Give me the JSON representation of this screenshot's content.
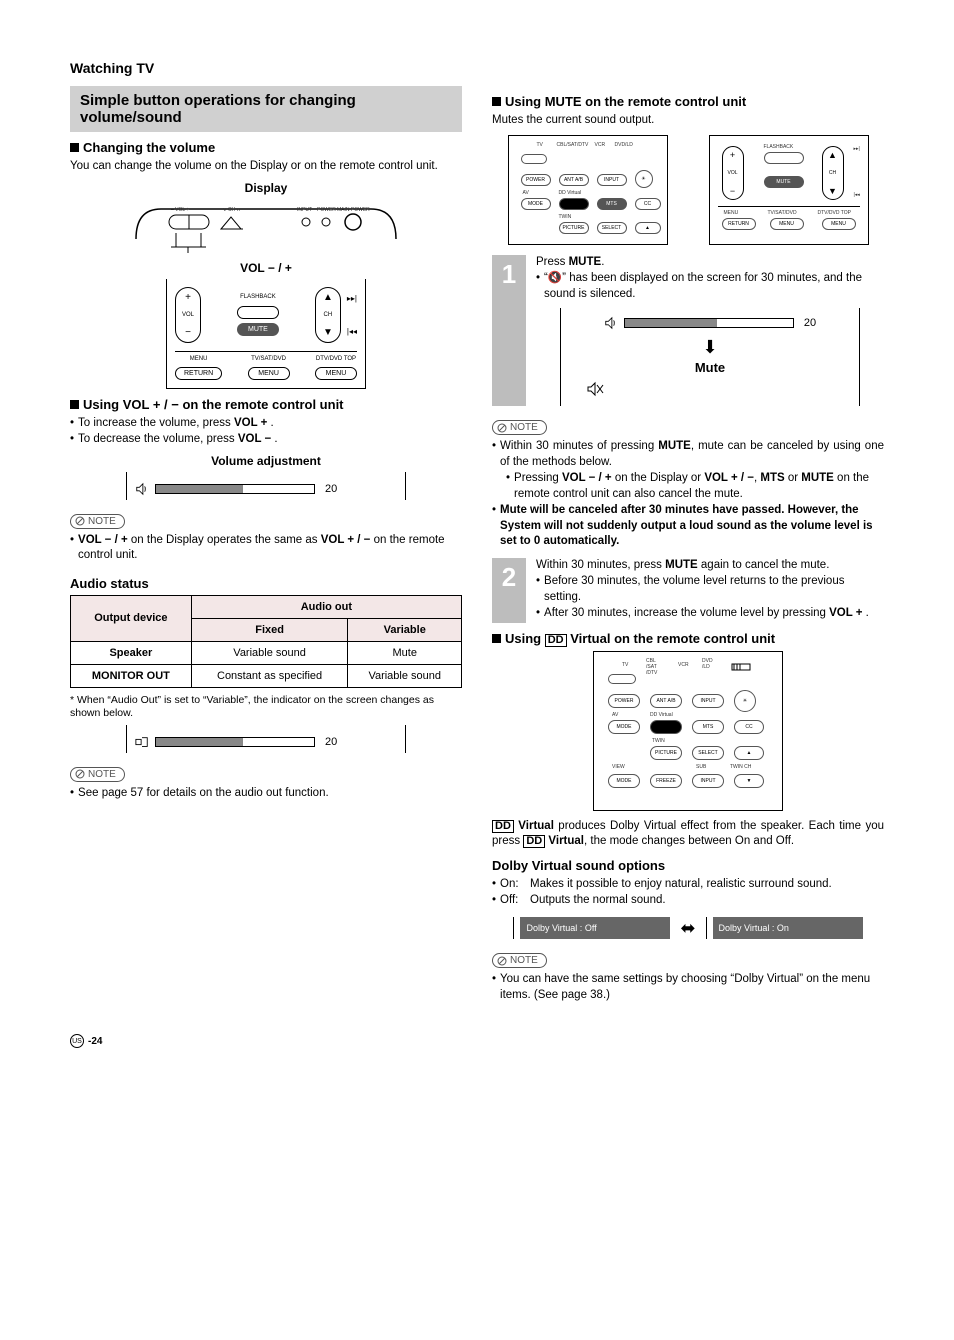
{
  "header": {
    "section": "Watching TV"
  },
  "grey_title": "Simple button operations for changing volume/sound",
  "left": {
    "changing_volume_head": "Changing the volume",
    "changing_volume_body": "You can change the volume on the Display or on the remote control unit.",
    "display_label": "Display",
    "vol_pm_label": "VOL − / +",
    "remote_labels": {
      "flashback": "FLASHBACK",
      "vol": "VOL",
      "mute": "MUTE",
      "ch": "CH",
      "menu": "MENU",
      "return": "RETURN",
      "tvsatdvd": "TV/SAT/DVD",
      "menu2": "MENU",
      "dtvtop": "DTV/DVD TOP",
      "menu3": "MENU"
    },
    "using_vol_head": "Using VOL + / − on the remote control unit",
    "inc_line": "To increase the volume, press ",
    "inc_bold": "VOL +",
    "dec_line": "To decrease the volume, press ",
    "dec_bold": "VOL −",
    "vol_adj_label": "Volume adjustment",
    "bar_value": "20",
    "note_label": "NOTE",
    "vol_note_a": "VOL − / +",
    "vol_note_b": " on the Display operates the same as ",
    "vol_note_c": "VOL + / −",
    "vol_note_d": " on the remote control unit.",
    "audio_status_head": "Audio status",
    "table": {
      "output_device": "Output device",
      "audio_out": "Audio out",
      "fixed": "Fixed",
      "variable": "Variable",
      "speaker": "Speaker",
      "speaker_fixed": "Variable sound",
      "speaker_var": "Mute",
      "monitor": "MONITOR OUT",
      "monitor_fixed": "Constant as specified",
      "monitor_var": "Variable sound"
    },
    "asterisk_note": "* When “Audio Out” is set to “Variable”, the indicator on the screen changes as shown below.",
    "bar2_value": "20",
    "audio_out_note": "See page 57 for details on the audio out function."
  },
  "right": {
    "mute_head": "Using MUTE on the remote control unit",
    "mute_intro": "Mutes the current sound output.",
    "step1_press": "Press ",
    "step1_mute": "MUTE",
    "step1_bullet": "“🔇” has been displayed on the screen for 30 minutes, and the sound is silenced.",
    "mute_bar_value": "20",
    "mute_label": "Mute",
    "note_label": "NOTE",
    "mute_note_1a": "Within 30 minutes of pressing ",
    "mute_note_1b": "MUTE",
    "mute_note_1c": ", mute can be canceled by using one of the methods below.",
    "mute_note_sub_a": "Pressing ",
    "mute_note_sub_b": "VOL − / +",
    "mute_note_sub_c": " on the Display or ",
    "mute_note_sub_d": "VOL + / −",
    "mute_note_sub_e": ", ",
    "mute_note_sub_f": "MTS",
    "mute_note_sub_g": " or ",
    "mute_note_sub_h": "MUTE",
    "mute_note_sub_i": " on the remote control unit can also cancel the mute.",
    "mute_note_2": "Mute will be canceled after 30 minutes have passed. However, the System will not suddenly output a loud sound as the volume level is set to 0 automatically.",
    "step2_a": "Within 30 minutes, press ",
    "step2_b": "MUTE",
    "step2_c": " again to cancel the mute.",
    "step2_bullet1": "Before 30 minutes, the volume level returns to the previous setting.",
    "step2_bullet2a": "After 30 minutes, increase the volume level by pressing ",
    "step2_bullet2b": "VOL +",
    "dv_head_pre": "Using ",
    "dv_head_icon": "DD",
    "dv_head_post": " Virtual on the remote control unit",
    "dv_body_a": " Virtual",
    "dv_body_b": " produces Dolby Virtual effect from the speaker. Each time you press ",
    "dv_body_c": " Virtual",
    "dv_body_d": ", the mode changes between On and Off.",
    "dv_options_head": "Dolby Virtual sound options",
    "dv_on_label": "On:",
    "dv_on_text": "Makes it possible to enjoy natural, realistic surround sound.",
    "dv_off_label": "Off:",
    "dv_off_text": "Outputs the normal sound.",
    "dv_state_off": "Dolby Virtual : Off",
    "dv_state_on": "Dolby Virtual : On",
    "dv_note": "You can have the same settings by choosing “Dolby Virtual” on the menu items. (See page 38.)"
  },
  "footer": {
    "region": "US",
    "page": "-24"
  }
}
